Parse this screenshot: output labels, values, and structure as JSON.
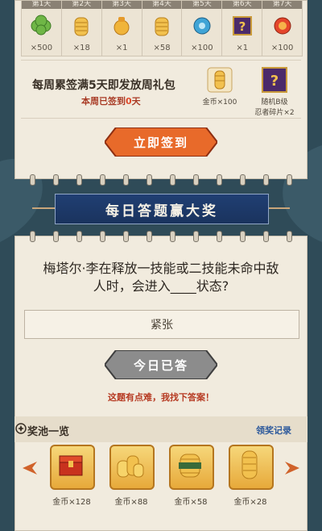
{
  "checkin": {
    "days": [
      {
        "label": "第1天",
        "icon": "gift-pack-icon",
        "qty": "×500"
      },
      {
        "label": "第2天",
        "icon": "coin-stack-icon",
        "qty": "×18"
      },
      {
        "label": "第3天",
        "icon": "gold-bag-icon",
        "qty": "×1"
      },
      {
        "label": "第4天",
        "icon": "coin-stack-icon",
        "qty": "×58"
      },
      {
        "label": "第5天",
        "icon": "blue-orb-icon",
        "qty": "×100"
      },
      {
        "label": "第6天",
        "icon": "mystery-shard-icon",
        "qty": "×1"
      },
      {
        "label": "第7天",
        "icon": "red-token-icon",
        "qty": "×100"
      }
    ],
    "weekly_title": "每周累签满5天即发放周礼包",
    "weekly_sub_prefix": "本周已签到",
    "weekly_sub_count": "0",
    "weekly_sub_suffix": "天",
    "weekly_rewards": [
      {
        "icon": "coin-stack-icon",
        "label": "金币×100"
      },
      {
        "icon": "mystery-shard-icon",
        "label1": "随机B级",
        "label2": "忍者碎片×2"
      }
    ],
    "signin_button": "立即签到"
  },
  "quiz": {
    "banner": "每日答题赢大奖",
    "question_line1": "梅塔尔·李在释放一技能或二技能未命中敌",
    "question_line2": "人时，会进入____状态?",
    "answer": "紧张",
    "answered_button": "今日已答",
    "help_text": "这题有点难，我找下答案！"
  },
  "pool": {
    "title": "奖池一览",
    "record_link": "领奖记录",
    "prizes": [
      {
        "icon": "treasure-chest-icon",
        "label": "金币×128"
      },
      {
        "icon": "coin-pile-icon",
        "label": "金币×88"
      },
      {
        "icon": "coin-pile-icon",
        "label": "金币×58"
      },
      {
        "icon": "coin-stack-icon",
        "label": "金币×28"
      }
    ]
  },
  "colors": {
    "accent_orange": "#e86a2a",
    "accent_red": "#c9301c",
    "banner_blue": "#1f3c6e",
    "paper": "#f1ebde"
  }
}
